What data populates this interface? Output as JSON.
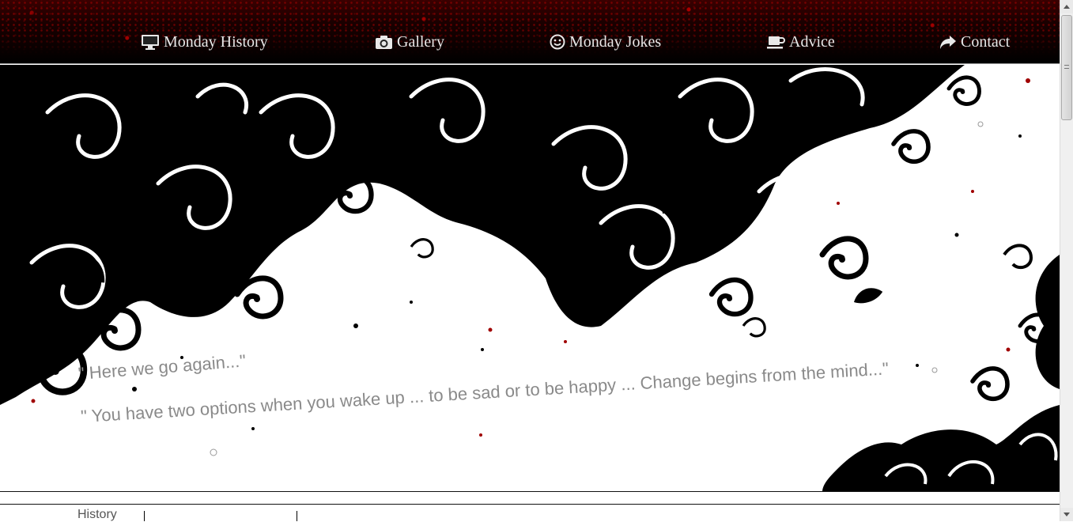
{
  "nav": {
    "items": [
      {
        "label": "Monday History",
        "icon": "monitor-icon"
      },
      {
        "label": "Gallery",
        "icon": "camera-icon"
      },
      {
        "label": "Monday Jokes",
        "icon": "smiley-icon"
      },
      {
        "label": "Advice",
        "icon": "coffee-cup-icon"
      },
      {
        "label": "Contact",
        "icon": "share-arrow-icon"
      }
    ]
  },
  "hero": {
    "quote1": "\" Here we go again...\"",
    "quote2": "\" You have two options when you wake up ... to be sad or to be happy ... Change begins from the mind...\""
  },
  "bottom": {
    "tab_label": "History"
  },
  "colors": {
    "nav_bg": "#000000",
    "nav_accent": "#a00000",
    "nav_text": "#e8e8e8",
    "quote_text": "#8a8a8a"
  }
}
